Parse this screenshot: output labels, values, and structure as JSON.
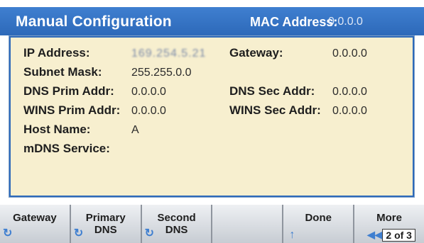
{
  "header": {
    "title": "Manual Configuration",
    "mac_label": "MAC Address:",
    "mac_value": "0.0.0.0"
  },
  "fields": {
    "ip_address": {
      "label": "IP Address:",
      "value": "169.254.5.21"
    },
    "gateway": {
      "label": "Gateway:",
      "value": "0.0.0.0"
    },
    "subnet_mask": {
      "label": "Subnet Mask:",
      "value": "255.255.0.0"
    },
    "dns_prim": {
      "label": "DNS Prim Addr:",
      "value": "0.0.0.0"
    },
    "dns_sec": {
      "label": "DNS Sec Addr:",
      "value": "0.0.0.0"
    },
    "wins_prim": {
      "label": "WINS Prim Addr:",
      "value": "0.0.0.0"
    },
    "wins_sec": {
      "label": "WINS Sec Addr:",
      "value": "0.0.0.0"
    },
    "host_name": {
      "label": "Host Name:",
      "value": "A"
    },
    "mdns_service": {
      "label": "mDNS Service:",
      "value": ""
    }
  },
  "softkeys": {
    "gateway": "Gateway",
    "primary_dns": "Primary\nDNS",
    "second_dns": "Second\nDNS",
    "blank": "",
    "done": "Done",
    "more": "More",
    "page_indicator": "2 of 3"
  },
  "colors": {
    "header_blue": "#2d69b9",
    "panel_bg": "#f7efcf",
    "softkey_gray": "#c7ccd3"
  },
  "icons": {
    "knob": "rotary-knob-icon",
    "arrow_up": "arrow-up-icon",
    "back": "double-left-arrow-icon"
  }
}
